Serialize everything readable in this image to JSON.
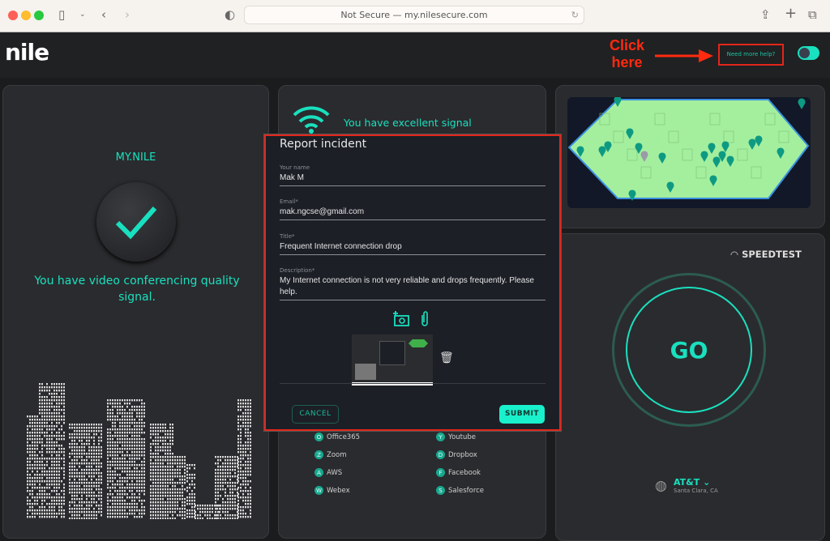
{
  "browser": {
    "url": "Not Secure — my.nilesecure.com"
  },
  "header": {
    "logo": "nile",
    "help_link": "Need more help?",
    "toggle_on": true
  },
  "annotation": {
    "line1": "Click",
    "line2": "here",
    "color": "#ff2a10"
  },
  "left_panel": {
    "title": "MY.NILE",
    "message": "You have video conferencing quality signal."
  },
  "middle_panel": {
    "signal_message": "You have excellent signal",
    "apps": [
      {
        "letter": "O",
        "name": "Office365"
      },
      {
        "letter": "Y",
        "name": "Youtube"
      },
      {
        "letter": "Z",
        "name": "Zoom"
      },
      {
        "letter": "D",
        "name": "Dropbox"
      },
      {
        "letter": "A",
        "name": "AWS"
      },
      {
        "letter": "F",
        "name": "Facebook"
      },
      {
        "letter": "W",
        "name": "Webex"
      },
      {
        "letter": "S",
        "name": "Salesforce"
      }
    ]
  },
  "speedtest": {
    "label": "SPEEDTEST",
    "go": "GO",
    "isp": "AT&T",
    "location": "Santa Clara, CA"
  },
  "modal": {
    "title": "Report incident",
    "fields": [
      {
        "label": "Your name",
        "value": "Mak M"
      },
      {
        "label": "Email*",
        "value": "mak.ngcse@gmail.com"
      },
      {
        "label": "Title*",
        "value": "Frequent Internet connection drop"
      },
      {
        "label": "Description*",
        "value": "My Internet connection is not very reliable and drops frequently. Please help."
      }
    ],
    "cancel": "CANCEL",
    "submit": "SUBMIT"
  },
  "colors": {
    "accent": "#19e0bf",
    "highlight": "#e3261b"
  }
}
